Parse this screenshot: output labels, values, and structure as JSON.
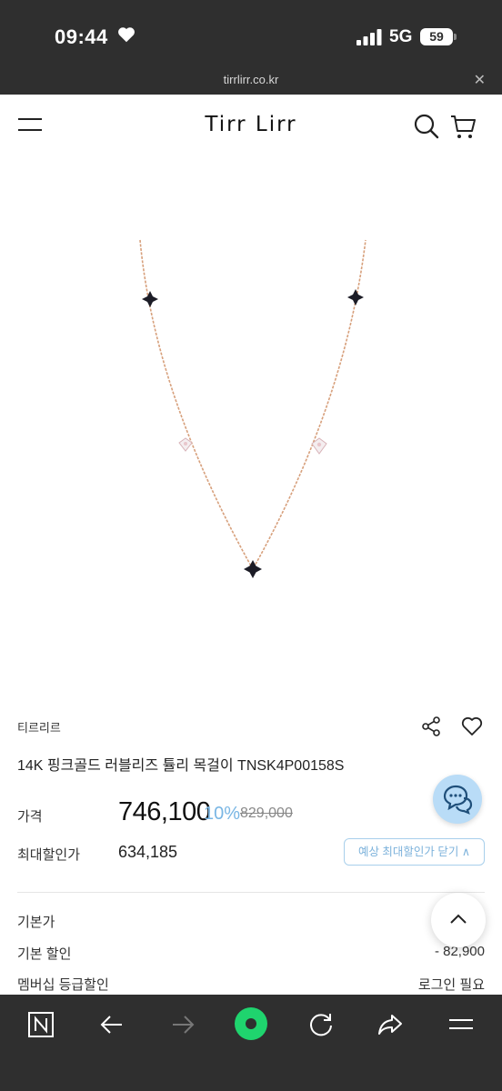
{
  "status_bar": {
    "time": "09:44",
    "network": "5G",
    "battery": "59"
  },
  "browser": {
    "url": "tirrlirr.co.kr"
  },
  "header": {
    "logo": "Tirr Lirr"
  },
  "product": {
    "brand": "티르리르",
    "title": "14K 핑크골드 러블리즈 튤리 목걸이 TNSK4P00158S",
    "price_label": "가격",
    "price": "746,100",
    "discount": "10%",
    "original_price": "829,000",
    "max_discount_label": "최대할인가",
    "max_discount_price": "634,185",
    "expect_button_label": "예상 최대할인가 닫기 ∧"
  },
  "breakdown": [
    {
      "label": "기본가",
      "value": ""
    },
    {
      "label": "기본 할인",
      "value": "- 82,900"
    },
    {
      "label": "멤버십 등급할인",
      "value": "로그인 필요"
    }
  ],
  "icons": {
    "menu": "hamburger-menu-icon",
    "search": "search-icon",
    "cart": "cart-icon",
    "share": "share-icon",
    "wishlist": "heart-icon",
    "chat": "chat-icon",
    "scroll_top": "chevron-up-icon",
    "bottom_nav": [
      "naver-home-icon",
      "back-arrow-icon",
      "forward-arrow-icon",
      "green-dot-icon",
      "refresh-icon",
      "share-icon",
      "menu-icon"
    ]
  },
  "colors": {
    "accent_blue": "#79b6e4",
    "chat_bg": "#b9dcf7",
    "green": "#1fd46e",
    "dark": "#2f2f2f"
  }
}
